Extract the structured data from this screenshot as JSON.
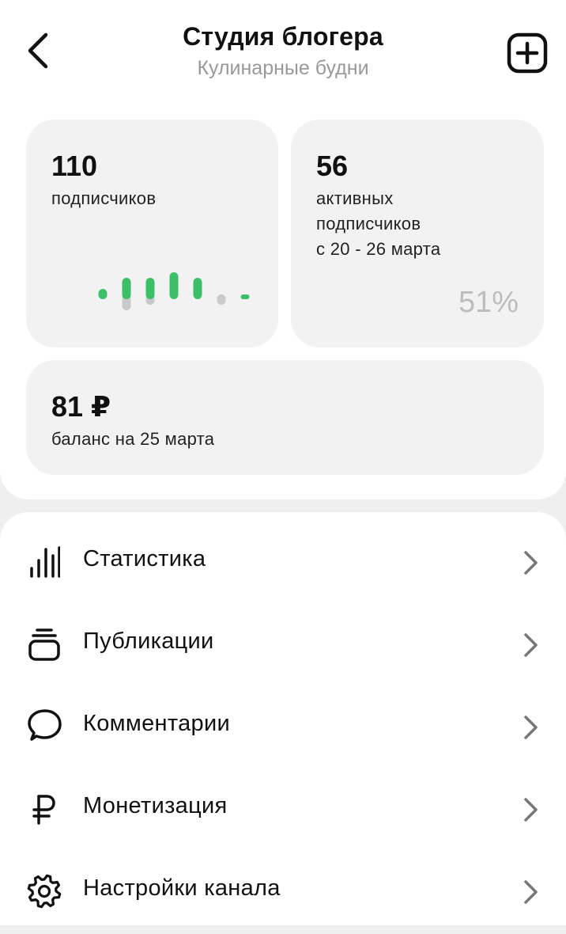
{
  "header": {
    "title": "Студия блогера",
    "subtitle": "Кулинарные будни",
    "back_icon": "chevron-left-icon",
    "add_icon": "plus-square-icon"
  },
  "cards": {
    "subscribers": {
      "value": "110",
      "label": "подписчиков",
      "trend": {
        "colors": {
          "gain": "#3dbf6a",
          "loss": "#c9c9c9"
        },
        "gains": [
          1,
          3,
          3,
          4,
          3,
          0,
          0
        ],
        "losses": [
          0,
          2,
          1,
          0,
          0,
          1,
          0
        ]
      }
    },
    "active": {
      "value": "56",
      "label_lines": [
        "активных",
        "подписчиков",
        "с 20 - 26 марта"
      ],
      "percent": "51%"
    },
    "balance": {
      "value": "81 ₽",
      "label": "баланс на 25 марта"
    }
  },
  "menu": {
    "items": [
      {
        "label": "Статистика",
        "icon": "bar-chart-icon"
      },
      {
        "label": "Публикации",
        "icon": "stack-icon"
      },
      {
        "label": "Комментарии",
        "icon": "chat-bubble-icon"
      },
      {
        "label": "Монетизация",
        "icon": "ruble-icon"
      },
      {
        "label": "Настройки канала",
        "icon": "gear-icon"
      }
    ]
  },
  "colors": {
    "card_background": "#f2f2f2",
    "accent_green": "#3dbf6a",
    "muted_text": "#999999"
  }
}
